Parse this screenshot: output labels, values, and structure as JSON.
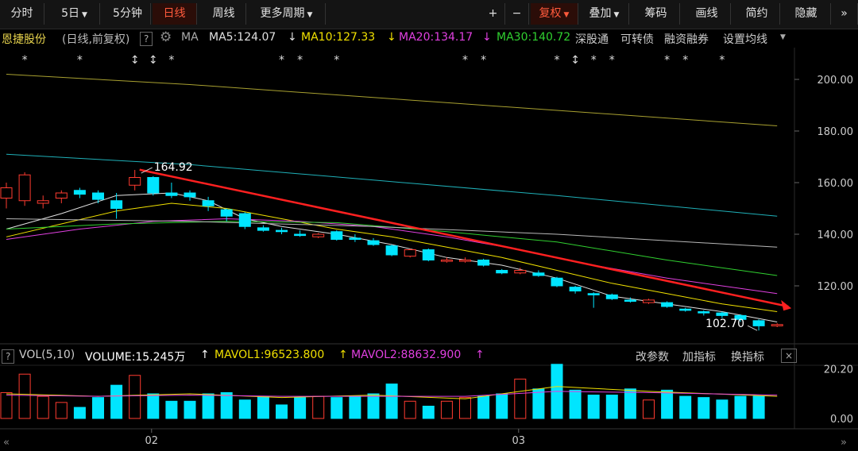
{
  "toolbar": {
    "period_items": [
      "分时",
      "5日",
      "5分钟",
      "日线",
      "周线",
      "更多周期"
    ],
    "dropdown_period": [
      "5日",
      "更多周期"
    ],
    "active_period": "日线",
    "plus": "+",
    "minus": "−",
    "restore_rights": "复权",
    "overlay": "叠加",
    "chips": "筹码",
    "draw": "画线",
    "simple": "简约",
    "hide": "隐藏",
    "expand": "»"
  },
  "info": {
    "stock_name": "恩捷股份",
    "period_desc": "(日线,前复权)",
    "help": "?",
    "indicator": "MA",
    "ma5": "MA5:124.07",
    "ma10": "MA10:127.33",
    "ma20": "MA20:134.17",
    "ma30": "MA30:140.72",
    "arrow": "↓",
    "links": [
      "深股通",
      "可转债",
      "融资融券",
      "设置均线"
    ]
  },
  "volume": {
    "label": "VOL(5,10)",
    "volume": "VOLUME:15.245万",
    "mavol1": "MAVOL1:96523.800",
    "mavol2": "MAVOL2:88632.900",
    "arrow": "↑",
    "buttons": [
      "改参数",
      "加指标",
      "换指标"
    ],
    "close": "×"
  },
  "colors": {
    "up": "#ff3b30",
    "down": "#00e5ff",
    "ma5": "#e0e0e0",
    "ma10": "#f0e000",
    "ma20": "#e040e0",
    "ma30": "#30d030",
    "trend": "#ff2020",
    "active": "#ff5a3c"
  },
  "chart_data": {
    "type": "candlestick",
    "price_axis": {
      "ticks": [
        200,
        180,
        160,
        140,
        120
      ],
      "tick_labels": [
        "200.00",
        "180.00",
        "160.00",
        "140.00",
        "120.00"
      ]
    },
    "volume_axis": {
      "ticks": [
        20.2,
        0
      ],
      "tick_labels": [
        "20.20",
        "0.00"
      ]
    },
    "x_tick_labels": [
      {
        "index": 8,
        "label": "02"
      },
      {
        "index": 28,
        "label": "03"
      }
    ],
    "annotations": {
      "high_label": "164.92",
      "high_index": 7,
      "low_label": "102.70",
      "low_index": 41
    },
    "event_marks": [
      {
        "index": 1,
        "symbol": "*"
      },
      {
        "index": 4,
        "symbol": "*"
      },
      {
        "index": 7,
        "symbol": "↕"
      },
      {
        "index": 8,
        "symbol": "↕"
      },
      {
        "index": 9,
        "symbol": "*"
      },
      {
        "index": 15,
        "symbol": "*"
      },
      {
        "index": 16,
        "symbol": "*"
      },
      {
        "index": 18,
        "symbol": "*"
      },
      {
        "index": 25,
        "symbol": "*"
      },
      {
        "index": 26,
        "symbol": "*"
      },
      {
        "index": 30,
        "symbol": "*"
      },
      {
        "index": 31,
        "symbol": "↕"
      },
      {
        "index": 32,
        "symbol": "*"
      },
      {
        "index": 33,
        "symbol": "*"
      },
      {
        "index": 36,
        "symbol": "*"
      },
      {
        "index": 37,
        "symbol": "*"
      },
      {
        "index": 39,
        "symbol": "*"
      }
    ],
    "candles": [
      {
        "o": 154,
        "c": 158,
        "h": 160,
        "l": 150
      },
      {
        "o": 153,
        "c": 163,
        "h": 164,
        "l": 151
      },
      {
        "o": 152,
        "c": 153,
        "h": 155,
        "l": 150
      },
      {
        "o": 154,
        "c": 156,
        "h": 157,
        "l": 152
      },
      {
        "o": 157,
        "c": 155.5,
        "h": 158,
        "l": 154
      },
      {
        "o": 156,
        "c": 153.5,
        "h": 157,
        "l": 152
      },
      {
        "o": 153,
        "c": 150,
        "h": 156,
        "l": 146
      },
      {
        "o": 159,
        "c": 162,
        "h": 164.92,
        "l": 157
      },
      {
        "o": 162,
        "c": 156,
        "h": 162.5,
        "l": 155
      },
      {
        "o": 156,
        "c": 155,
        "h": 160,
        "l": 154
      },
      {
        "o": 156,
        "c": 154.5,
        "h": 157,
        "l": 153
      },
      {
        "o": 153,
        "c": 151,
        "h": 154.5,
        "l": 149
      },
      {
        "o": 149.5,
        "c": 147,
        "h": 150,
        "l": 145
      },
      {
        "o": 148,
        "c": 143,
        "h": 148.5,
        "l": 142
      },
      {
        "o": 142.5,
        "c": 141.5,
        "h": 143.5,
        "l": 141
      },
      {
        "o": 141.5,
        "c": 141,
        "h": 142.5,
        "l": 140
      },
      {
        "o": 140,
        "c": 139.5,
        "h": 141.5,
        "l": 139
      },
      {
        "o": 139,
        "c": 140,
        "h": 140.5,
        "l": 138.5
      },
      {
        "o": 141,
        "c": 138,
        "h": 141.5,
        "l": 137.5
      },
      {
        "o": 138.5,
        "c": 138,
        "h": 140,
        "l": 137
      },
      {
        "o": 137.5,
        "c": 136,
        "h": 138.5,
        "l": 135.5
      },
      {
        "o": 135.5,
        "c": 132,
        "h": 136,
        "l": 131.5
      },
      {
        "o": 131.5,
        "c": 134,
        "h": 134.5,
        "l": 131
      },
      {
        "o": 134,
        "c": 130,
        "h": 134.5,
        "l": 129.5
      },
      {
        "o": 129.5,
        "c": 130,
        "h": 131,
        "l": 129
      },
      {
        "o": 129.5,
        "c": 130,
        "h": 131,
        "l": 129
      },
      {
        "o": 130,
        "c": 128,
        "h": 130.5,
        "l": 127.5
      },
      {
        "o": 126,
        "c": 125,
        "h": 126.5,
        "l": 124.5
      },
      {
        "o": 125,
        "c": 126,
        "h": 127,
        "l": 124.5
      },
      {
        "o": 125,
        "c": 124,
        "h": 126,
        "l": 123.5
      },
      {
        "o": 123,
        "c": 120,
        "h": 123.5,
        "l": 119.5
      },
      {
        "o": 119.5,
        "c": 118,
        "h": 120,
        "l": 117
      },
      {
        "o": 117,
        "c": 116.5,
        "h": 117.5,
        "l": 111.5
      },
      {
        "o": 116.5,
        "c": 115,
        "h": 117,
        "l": 114.5
      },
      {
        "o": 114.5,
        "c": 114,
        "h": 115.5,
        "l": 113.5
      },
      {
        "o": 113.5,
        "c": 114.5,
        "h": 115,
        "l": 113
      },
      {
        "o": 113.5,
        "c": 112,
        "h": 114,
        "l": 111.5
      },
      {
        "o": 111,
        "c": 110.5,
        "h": 111.5,
        "l": 110
      },
      {
        "o": 110,
        "c": 109.5,
        "h": 110.5,
        "l": 108.5
      },
      {
        "o": 109.5,
        "c": 108.5,
        "h": 110,
        "l": 107.5
      },
      {
        "o": 108.5,
        "c": 107,
        "h": 109,
        "l": 106
      },
      {
        "o": 106.5,
        "c": 104.5,
        "h": 107,
        "l": 102.7
      },
      {
        "o": 104.5,
        "c": 105,
        "h": 105.5,
        "l": 104
      }
    ],
    "volumes": [
      10.5,
      18,
      9,
      6.5,
      4.5,
      8.5,
      13.5,
      17.5,
      10,
      7,
      7,
      10,
      10.5,
      7.5,
      9,
      5.5,
      8.5,
      9,
      8.5,
      9,
      10,
      14,
      7,
      5,
      7,
      8.5,
      9,
      10,
      16,
      12,
      22,
      11.5,
      9.5,
      9.5,
      12,
      7.5,
      11.5,
      9,
      8.5,
      7.5,
      9,
      9
    ],
    "ma_lines": [
      {
        "name": "MA5",
        "values": [
          [
            0,
            142
          ],
          [
            3,
            148
          ],
          [
            6,
            155
          ],
          [
            9,
            156
          ],
          [
            11,
            153
          ],
          [
            13,
            146
          ],
          [
            15,
            143
          ],
          [
            18,
            140
          ],
          [
            21,
            136
          ],
          [
            24,
            131
          ],
          [
            27,
            128
          ],
          [
            30,
            123
          ],
          [
            33,
            116
          ],
          [
            36,
            113
          ],
          [
            39,
            110
          ],
          [
            42,
            106
          ]
        ]
      },
      {
        "name": "MA10",
        "values": [
          [
            0,
            139
          ],
          [
            3,
            144
          ],
          [
            6,
            149
          ],
          [
            9,
            152
          ],
          [
            12,
            150
          ],
          [
            15,
            146
          ],
          [
            18,
            142
          ],
          [
            21,
            139
          ],
          [
            24,
            135
          ],
          [
            27,
            131
          ],
          [
            30,
            126
          ],
          [
            33,
            121
          ],
          [
            36,
            117
          ],
          [
            39,
            113
          ],
          [
            42,
            110
          ]
        ]
      },
      {
        "name": "MA20",
        "values": [
          [
            0,
            138
          ],
          [
            4,
            142
          ],
          [
            8,
            145
          ],
          [
            12,
            146
          ],
          [
            16,
            145
          ],
          [
            20,
            143
          ],
          [
            24,
            139
          ],
          [
            28,
            134
          ],
          [
            32,
            128
          ],
          [
            36,
            123
          ],
          [
            40,
            119
          ],
          [
            42,
            117
          ]
        ]
      },
      {
        "name": "MA30",
        "values": [
          [
            0,
            142
          ],
          [
            6,
            144
          ],
          [
            12,
            145
          ],
          [
            18,
            144.5
          ],
          [
            24,
            141
          ],
          [
            30,
            137
          ],
          [
            36,
            130
          ],
          [
            40,
            126
          ],
          [
            42,
            124
          ]
        ]
      },
      {
        "name": "MA60",
        "values": [
          [
            0,
            146
          ],
          [
            10,
            145
          ],
          [
            20,
            143
          ],
          [
            30,
            140
          ],
          [
            42,
            135
          ]
        ]
      },
      {
        "name": "MA120",
        "values": [
          [
            0,
            171
          ],
          [
            10,
            167
          ],
          [
            20,
            161
          ],
          [
            30,
            155
          ],
          [
            42,
            147
          ]
        ]
      },
      {
        "name": "MA250",
        "values": [
          [
            0,
            202
          ],
          [
            10,
            198
          ],
          [
            20,
            193
          ],
          [
            30,
            188
          ],
          [
            42,
            182
          ]
        ]
      }
    ],
    "vol_ma_lines": [
      {
        "name": "MAVOL1",
        "values": [
          [
            0,
            10
          ],
          [
            5,
            9
          ],
          [
            10,
            10
          ],
          [
            15,
            8.5
          ],
          [
            20,
            9.5
          ],
          [
            25,
            8
          ],
          [
            30,
            13
          ],
          [
            35,
            11
          ],
          [
            42,
            9
          ]
        ]
      },
      {
        "name": "MAVOL2",
        "values": [
          [
            0,
            9.5
          ],
          [
            5,
            9
          ],
          [
            10,
            9.5
          ],
          [
            15,
            9
          ],
          [
            20,
            9
          ],
          [
            25,
            9
          ],
          [
            30,
            11
          ],
          [
            35,
            10.5
          ],
          [
            42,
            9.5
          ]
        ]
      }
    ]
  }
}
